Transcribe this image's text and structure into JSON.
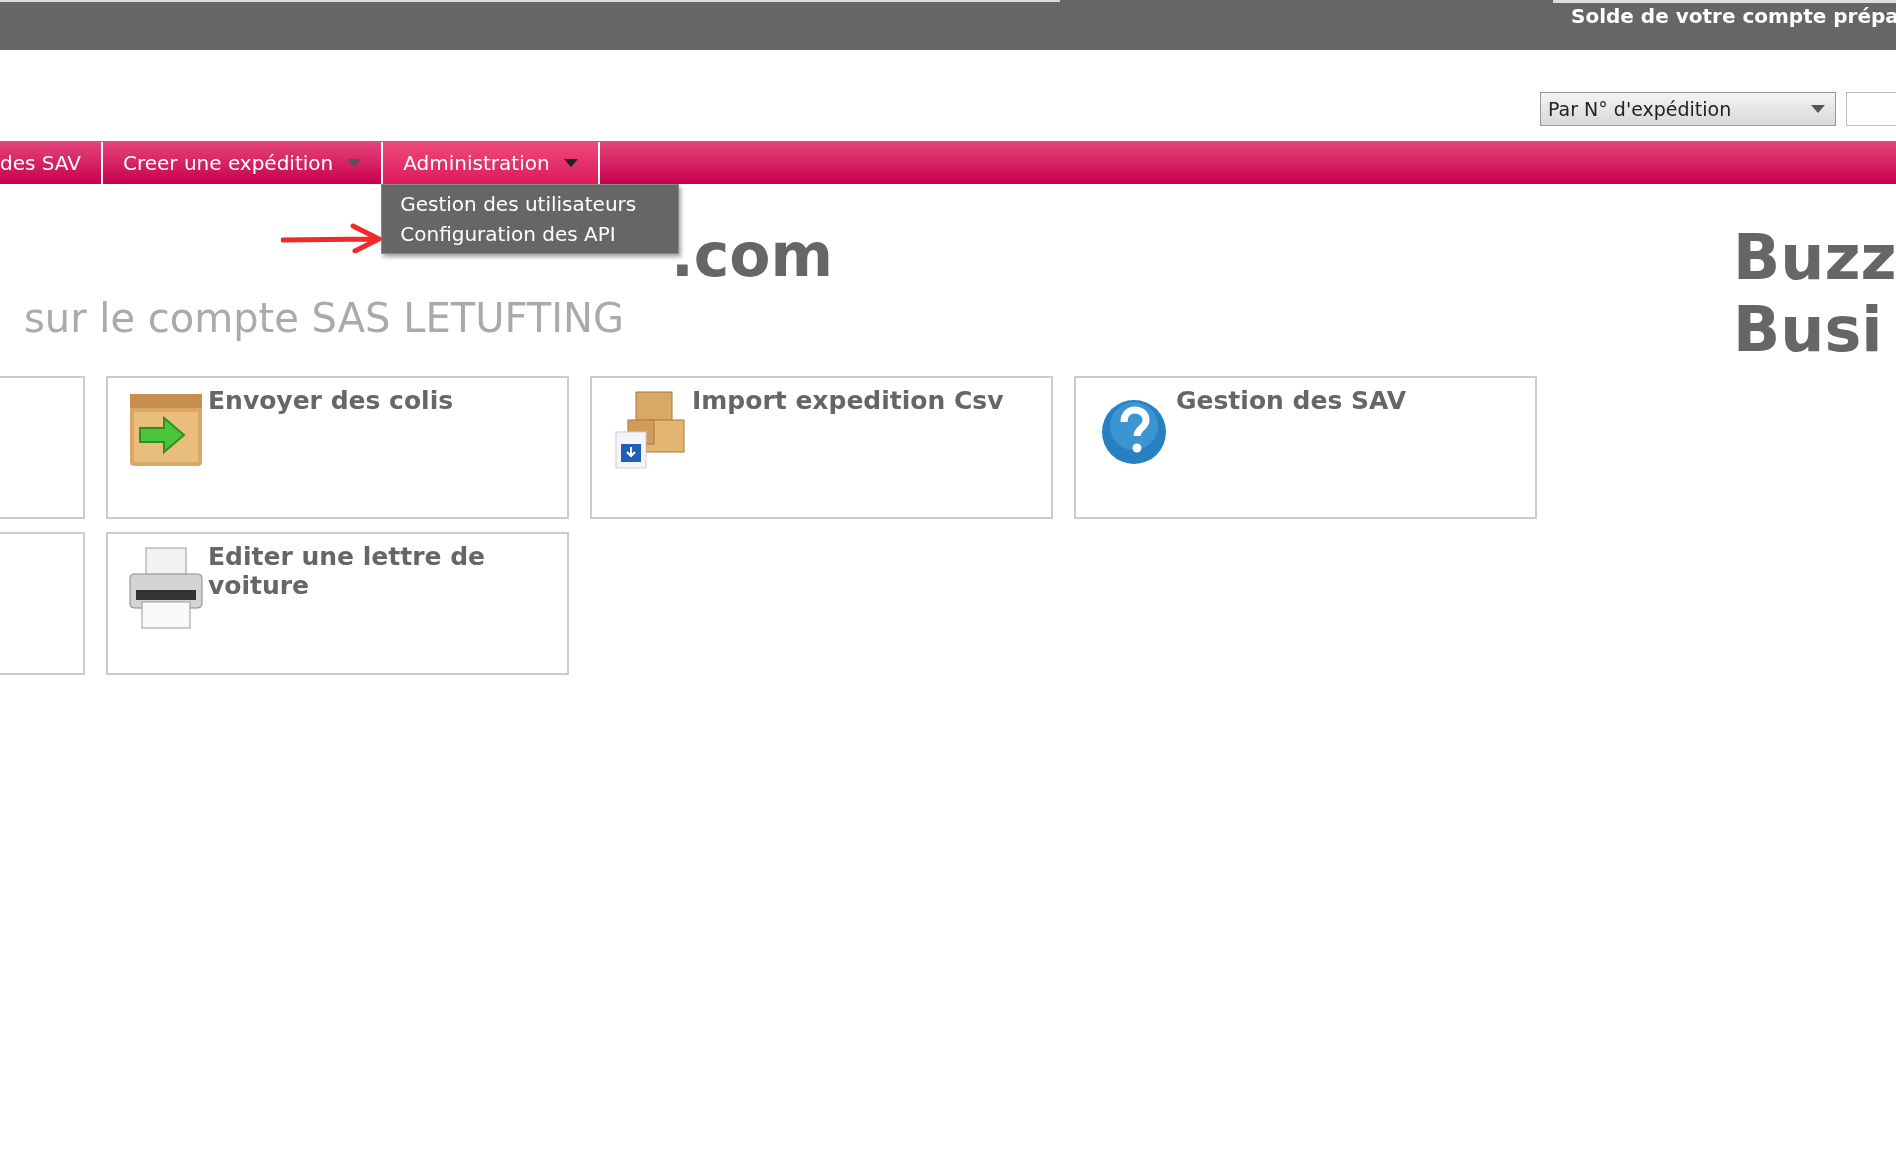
{
  "top_bar": {
    "balance_label": "Solde de votre compte prépa"
  },
  "search": {
    "select_value": "Par N° d'expédition"
  },
  "nav": [
    {
      "label": "des SAV",
      "selected": false,
      "has_menu": false
    },
    {
      "label": "Creer une expédition",
      "selected": false,
      "has_menu": true
    },
    {
      "label": "Administration",
      "selected": true,
      "has_menu": true
    }
  ],
  "dropdown_menu": [
    "Gestion des utilisateurs",
    "Configuration des API"
  ],
  "heading": ".com",
  "subtitle": "sur le compte SAS LETUFTING",
  "brand_lines": [
    "Buzz",
    "Busi"
  ],
  "tiles": [
    {
      "kind": "partial"
    },
    {
      "kind": "crate",
      "title": "Envoyer des colis"
    },
    {
      "kind": "boxes",
      "title": "Import expedition Csv"
    },
    {
      "kind": "help",
      "title": "Gestion des SAV"
    },
    {
      "kind": "partial"
    },
    {
      "kind": "printer",
      "title": "Editer une lettre de voiture"
    }
  ]
}
